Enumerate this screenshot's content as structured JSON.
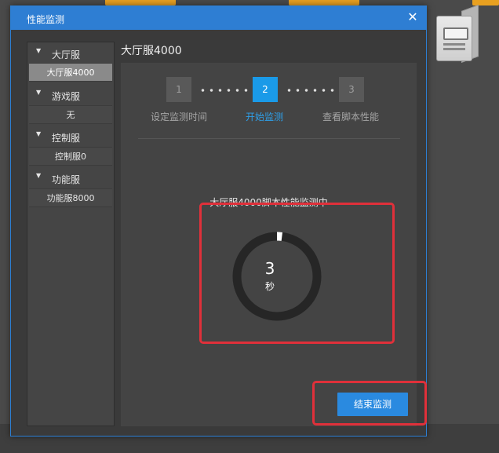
{
  "dialog": {
    "title": "性能监测",
    "close_glyph": "✕"
  },
  "sidebar": {
    "groups": [
      {
        "label": "大厅服",
        "items": [
          "大厅服4000"
        ]
      },
      {
        "label": "游戏服",
        "items": [
          "无"
        ]
      },
      {
        "label": "控制服",
        "items": [
          "控制服0"
        ]
      },
      {
        "label": "功能服",
        "items": [
          "功能服8000"
        ]
      }
    ],
    "selected": "大厅服4000",
    "expand_glyph": "▼"
  },
  "panel": {
    "title": "大厅服4000",
    "steps": [
      {
        "number": "1",
        "label": "设定监测时间"
      },
      {
        "number": "2",
        "label": "开始监测"
      },
      {
        "number": "3",
        "label": "查看脚本性能"
      }
    ],
    "active_step": 2,
    "monitor_text": "大厅服4000脚本性能监测中",
    "countdown": {
      "value": "3",
      "unit": "秒",
      "progress": 0.02
    },
    "end_button": "结束监测"
  },
  "colors": {
    "accent": "#2e7ed3",
    "active_step": "#1a9ae8",
    "annotation": "#e0303a"
  }
}
